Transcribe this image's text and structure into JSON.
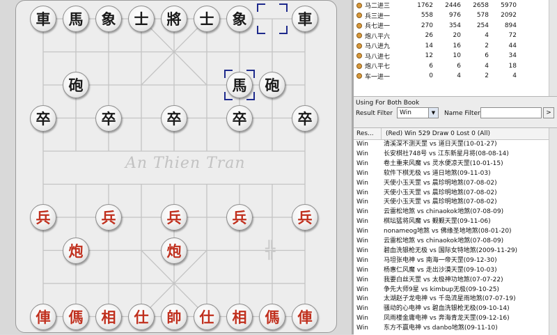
{
  "board": {
    "watermark": "An Thien Tran",
    "river_mark": "╬"
  },
  "pieces": [
    {
      "t": "車",
      "side": "black",
      "c": 0,
      "r": 0
    },
    {
      "t": "馬",
      "side": "black",
      "c": 1,
      "r": 0
    },
    {
      "t": "象",
      "side": "black",
      "c": 2,
      "r": 0
    },
    {
      "t": "士",
      "side": "black",
      "c": 3,
      "r": 0
    },
    {
      "t": "將",
      "side": "black",
      "c": 4,
      "r": 0
    },
    {
      "t": "士",
      "side": "black",
      "c": 5,
      "r": 0
    },
    {
      "t": "象",
      "side": "black",
      "c": 6,
      "r": 0
    },
    {
      "t": "車",
      "side": "black",
      "c": 8,
      "r": 0
    },
    {
      "t": "砲",
      "side": "black",
      "c": 1,
      "r": 2
    },
    {
      "t": "馬",
      "side": "black",
      "c": 6,
      "r": 2
    },
    {
      "t": "砲",
      "side": "black",
      "c": 7,
      "r": 2
    },
    {
      "t": "卒",
      "side": "black",
      "c": 0,
      "r": 3
    },
    {
      "t": "卒",
      "side": "black",
      "c": 2,
      "r": 3
    },
    {
      "t": "卒",
      "side": "black",
      "c": 4,
      "r": 3
    },
    {
      "t": "卒",
      "side": "black",
      "c": 6,
      "r": 3
    },
    {
      "t": "卒",
      "side": "black",
      "c": 8,
      "r": 3
    },
    {
      "t": "兵",
      "side": "red",
      "c": 0,
      "r": 6
    },
    {
      "t": "兵",
      "side": "red",
      "c": 2,
      "r": 6
    },
    {
      "t": "兵",
      "side": "red",
      "c": 4,
      "r": 6
    },
    {
      "t": "兵",
      "side": "red",
      "c": 6,
      "r": 6
    },
    {
      "t": "兵",
      "side": "red",
      "c": 8,
      "r": 6
    },
    {
      "t": "炮",
      "side": "red",
      "c": 1,
      "r": 7
    },
    {
      "t": "炮",
      "side": "red",
      "c": 4,
      "r": 7
    },
    {
      "t": "俥",
      "side": "red",
      "c": 0,
      "r": 9
    },
    {
      "t": "傌",
      "side": "red",
      "c": 1,
      "r": 9
    },
    {
      "t": "相",
      "side": "red",
      "c": 2,
      "r": 9
    },
    {
      "t": "仕",
      "side": "red",
      "c": 3,
      "r": 9
    },
    {
      "t": "帥",
      "side": "red",
      "c": 4,
      "r": 9
    },
    {
      "t": "仕",
      "side": "red",
      "c": 5,
      "r": 9
    },
    {
      "t": "相",
      "side": "red",
      "c": 6,
      "r": 9
    },
    {
      "t": "傌",
      "side": "red",
      "c": 7,
      "r": 9
    },
    {
      "t": "俥",
      "side": "red",
      "c": 8,
      "r": 9
    }
  ],
  "selection_markers": [
    {
      "c": 7,
      "r": 0
    },
    {
      "c": 6,
      "r": 2
    }
  ],
  "colors": {
    "selection": "#1e2a8c",
    "red_piece": "#c0301e",
    "black_piece": "#1a1a1a"
  },
  "moves": [
    {
      "name": "马二进三",
      "a": "1762",
      "b": "2446",
      "c": "2658",
      "d": "5970"
    },
    {
      "name": "兵三进一",
      "a": "558",
      "b": "976",
      "c": "578",
      "d": "2092"
    },
    {
      "name": "兵七进一",
      "a": "270",
      "b": "354",
      "c": "254",
      "d": "894"
    },
    {
      "name": "炮八平六",
      "a": "26",
      "b": "20",
      "c": "4",
      "d": "72"
    },
    {
      "name": "马八进九",
      "a": "14",
      "b": "16",
      "c": "2",
      "d": "44"
    },
    {
      "name": "马八进七",
      "a": "12",
      "b": "10",
      "c": "6",
      "d": "34"
    },
    {
      "name": "炮八平七",
      "a": "6",
      "b": "6",
      "c": "4",
      "d": "18"
    },
    {
      "name": "车一进一",
      "a": "0",
      "b": "4",
      "c": "2",
      "d": "4"
    }
  ],
  "filter_panel": {
    "using": "Using For Both Book",
    "result_filter_label": "Result Filter",
    "result_filter_value": "Win",
    "name_filter_label": "Name Filter",
    "go_label": ">"
  },
  "games_header": {
    "col1": "Res...",
    "col2": "(Red) Win 529 Draw 0 Lost 0 (All)"
  },
  "games": [
    {
      "r": "Win",
      "g": "清溪深不测天罡 vs 道日天罡(10-01-27)"
    },
    {
      "r": "Win",
      "g": "长安棋社748号 vs 江东新星月将(08-08-14)"
    },
    {
      "r": "Win",
      "g": "卷土重来风魔 vs 灵水便凉天罡(10-01-15)"
    },
    {
      "r": "Win",
      "g": "软件下棋无极 vs 道日地煞(09-11-03)"
    },
    {
      "r": "Win",
      "g": "天使小玉天罡 vs 晨珍明地煞(07-08-02)"
    },
    {
      "r": "Win",
      "g": "天使小玉天罡 vs 晨珍明地煞(07-08-02)"
    },
    {
      "r": "Win",
      "g": "天使小玉天罡 vs 晨珍明地煞(07-08-02)"
    },
    {
      "r": "Win",
      "g": "云雷松地煞 vs chinaokok地煞(07-08-09)"
    },
    {
      "r": "Win",
      "g": "棋坛猛将风魔 vs 觐觐天罡(09-11-06)"
    },
    {
      "r": "Win",
      "g": "nonameog地煞 vs 佛缘圣地地煞(08-01-20)"
    },
    {
      "r": "Win",
      "g": "云雷松地煞 vs chinaokok地煞(07-08-09)"
    },
    {
      "r": "Win",
      "g": "碧血洗银枪无极 vs 国际女特地煞(2009-11-29)"
    },
    {
      "r": "Win",
      "g": "马坦张电神 vs 南海一帝天罡(09-12-30)"
    },
    {
      "r": "Win",
      "g": "杨惠仁风魔 vs 走出沙漠天罡(09-10-03)"
    },
    {
      "r": "Win",
      "g": "我要白丝天罡 vs 太极神功地煞(07-07-22)"
    },
    {
      "r": "Win",
      "g": "争先大师9星 vs kimbup无极(09-10-25)"
    },
    {
      "r": "Win",
      "g": "太湖赵子龙电神 vs 千岛流星雨地煞(07-07-19)"
    },
    {
      "r": "Win",
      "g": "骚动的心电神 vs 碧血洗银枪无极(09-10-14)"
    },
    {
      "r": "Win",
      "g": "凤雨楼金庸电神 vs 奔海青龙天罡(09-12-16)"
    },
    {
      "r": "Win",
      "g": "东方不赢电神 vs danbo地煞(09-11-10)"
    }
  ]
}
